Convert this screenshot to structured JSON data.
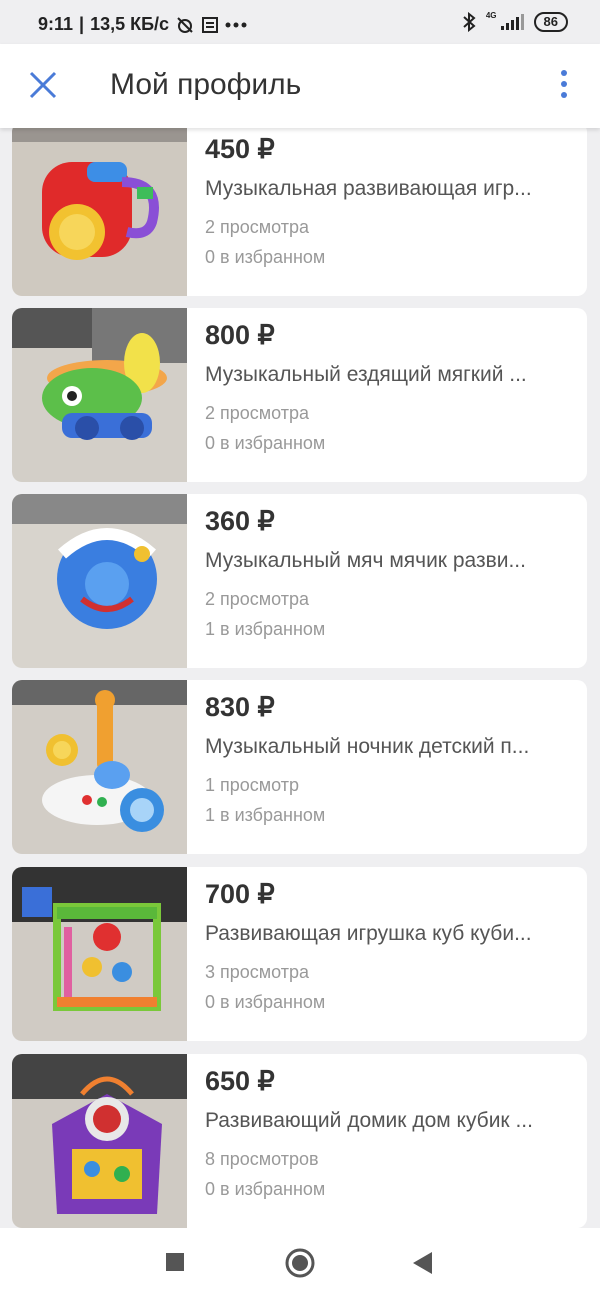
{
  "status_bar": {
    "time": "9:11",
    "net_speed": "13,5 КБ/с",
    "network_type": "4G",
    "battery": "86"
  },
  "app_bar": {
    "title": "Мой профиль",
    "close_icon": "close-icon",
    "menu_icon": "more-vert-icon"
  },
  "listings": [
    {
      "price": "450 ₽",
      "title": "Музыкальная развивающая игр...",
      "views": "2 просмотра",
      "favorites": "0 в избранном"
    },
    {
      "price": "800 ₽",
      "title": "Музыкальный ездящий мягкий ...",
      "views": "2 просмотра",
      "favorites": "0 в избранном"
    },
    {
      "price": "360 ₽",
      "title": "Музыкальный мяч мячик разви...",
      "views": "2 просмотра",
      "favorites": "1 в избранном"
    },
    {
      "price": "830 ₽",
      "title": "Музыкальный ночник детский п...",
      "views": "1 просмотр",
      "favorites": "1 в избранном"
    },
    {
      "price": "700 ₽",
      "title": "Развивающая игрушка куб куби...",
      "views": "3 просмотра",
      "favorites": "0 в избранном"
    },
    {
      "price": "650 ₽",
      "title": "Развивающий домик дом кубик ...",
      "views": "8 просмотров",
      "favorites": "0 в избранном"
    }
  ],
  "nav_bar": {
    "recents_icon": "square-icon",
    "home_icon": "circle-icon",
    "back_icon": "triangle-back-icon"
  },
  "colors": {
    "accent": "#4a7bd8",
    "background": "#efeff1",
    "card": "#ffffff"
  }
}
